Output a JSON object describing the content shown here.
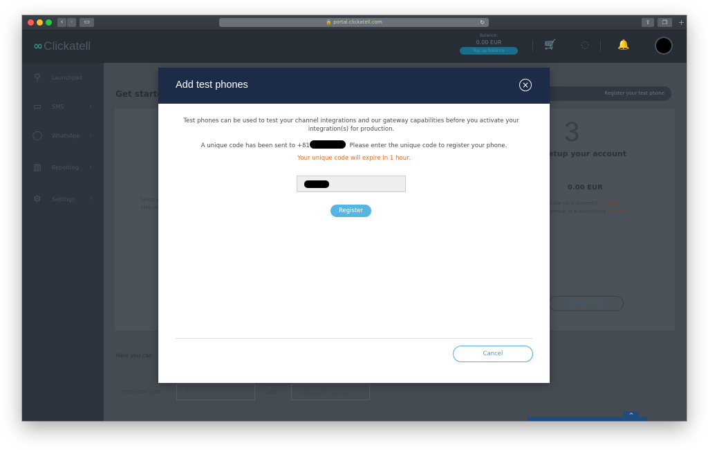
{
  "browser": {
    "url": "portal.clickatell.com",
    "back_icon": "chevron-left-icon",
    "forward_icon": "chevron-right-icon",
    "sidebar_toggle_icon": "sidebar-icon",
    "reload_icon": "reload-icon",
    "share_icon": "share-icon",
    "tabs_icon": "tabs-icon",
    "new_tab_label": "+"
  },
  "header": {
    "brand": "Clickatell",
    "balance_label": "Balance:",
    "balance_value": "0.00 EUR",
    "top_up_label": "Top up balance"
  },
  "sidebar": {
    "items": [
      {
        "label": "Launchpad",
        "icon": "rocket-icon"
      },
      {
        "label": "SMS",
        "icon": "chat-icon"
      },
      {
        "label": "WhatsApp",
        "icon": "whatsapp-icon"
      },
      {
        "label": "Reporting",
        "icon": "bar-chart-icon"
      },
      {
        "label": "Settings",
        "icon": "gear-icon"
      }
    ]
  },
  "main": {
    "title": "Get started",
    "register_button": "Register your test phone",
    "step3_number": "3",
    "step3_title": "etup your account",
    "step3_balance": "0.00 EUR",
    "step3_note1_prefix": "o top up is currently ",
    "step3_note2_prefix": "enewal of subscriptions ",
    "disabled_word": "disabled",
    "setup_billing_button": "Setup billing",
    "left_faded_1": "Setup y",
    "left_faded_2": "SMS int",
    "here_text": "Here you can",
    "filter_type_label": "Integration Type:",
    "filter_type_value": "All",
    "filter_sort_label": "Sort:",
    "filter_sort_value": "Integration name",
    "scroll_top_label": "^"
  },
  "modal": {
    "title": "Add test phones",
    "description": "Test phones can be used to test your channel integrations and our gateway capabilities before you activate your integration(s) for production.",
    "sent_prefix": "A unique code has been sent to +81",
    "sent_suffix": " Please enter the unique code to register your phone.",
    "expire_text": "Your unique code will expire in 1 hour.",
    "register_button": "Register",
    "cancel_button": "Cancel",
    "close_symbol": "×"
  },
  "colors": {
    "modal_header": "#1b2b48",
    "accent_blue": "#55b6e4",
    "warning_orange": "#e8691e"
  }
}
